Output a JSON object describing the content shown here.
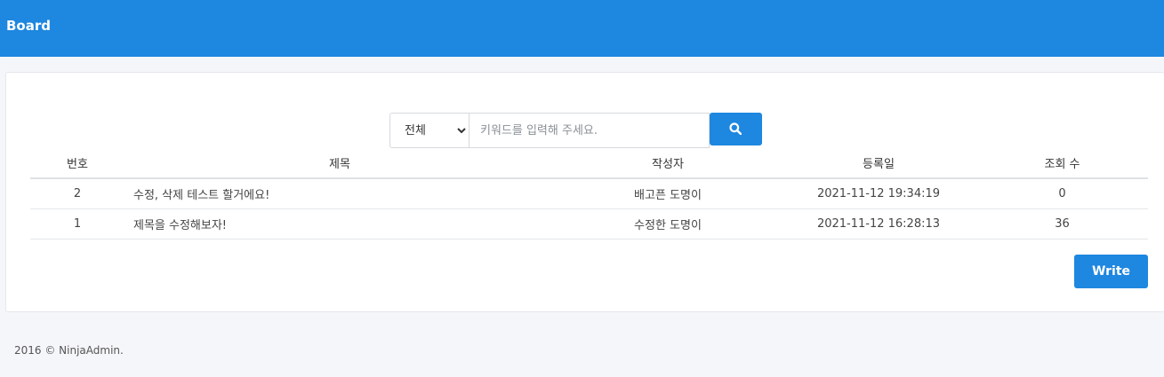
{
  "header": {
    "title": "Board"
  },
  "search": {
    "selected_option": "전체",
    "placeholder": "키워드를 입력해 주세요.",
    "icon": "search-icon"
  },
  "table": {
    "columns": [
      "번호",
      "제목",
      "작성자",
      "등록일",
      "조회 수"
    ],
    "rows": [
      {
        "no": "2",
        "title": "수정, 삭제 테스트 할거에요!",
        "writer": "배고픈 도명이",
        "date": "2021-11-12 19:34:19",
        "views": "0"
      },
      {
        "no": "1",
        "title": "제목을 수정해보자!",
        "writer": "수정한 도명이",
        "date": "2021-11-12 16:28:13",
        "views": "36"
      }
    ]
  },
  "actions": {
    "write_label": "Write"
  },
  "footer": {
    "text": "2016 © NinjaAdmin."
  },
  "colors": {
    "accent": "#1e87e0",
    "background": "#f5f6f9"
  }
}
